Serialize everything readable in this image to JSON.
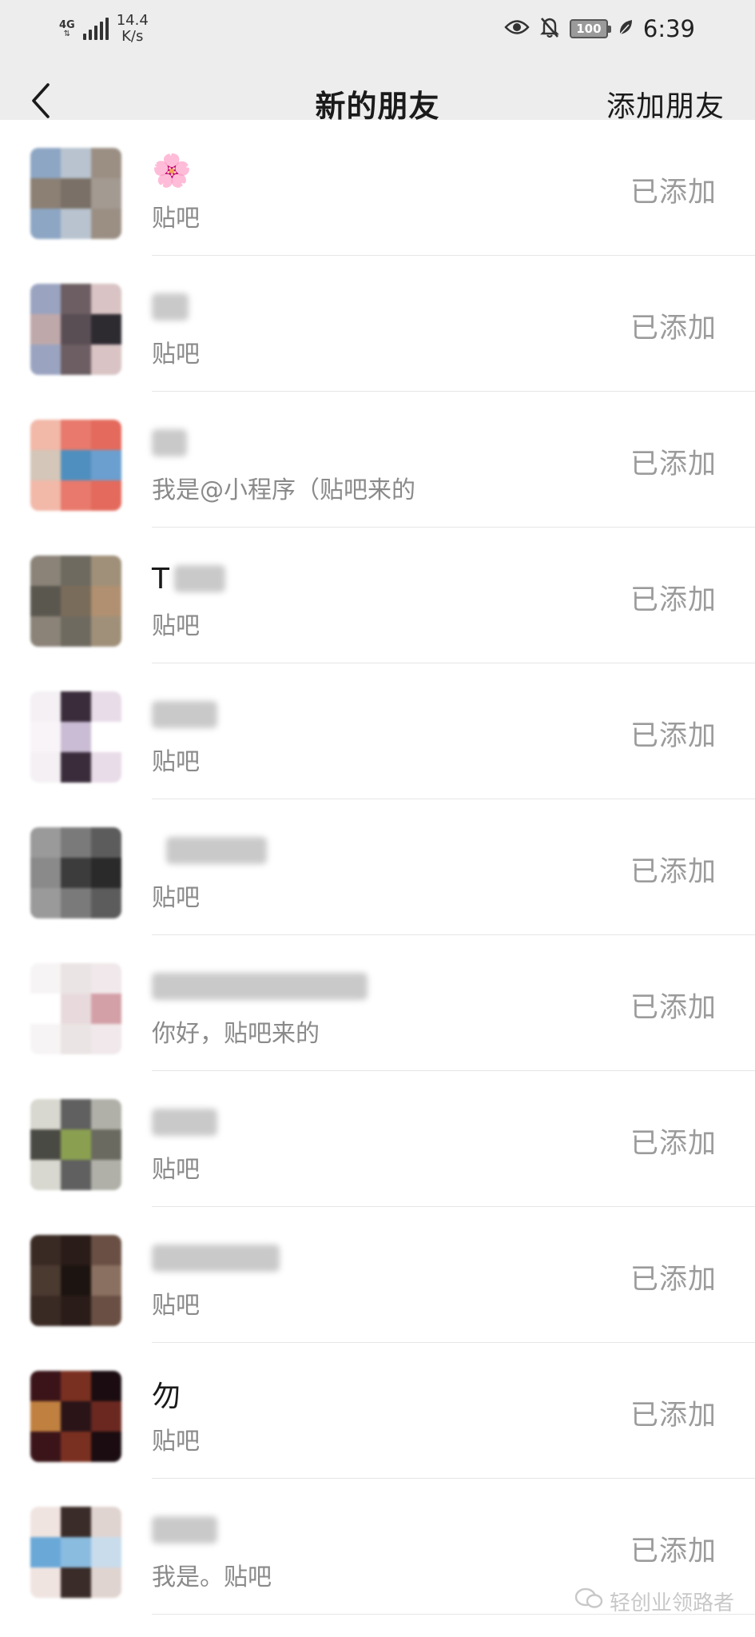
{
  "status_bar": {
    "net_type": "4G",
    "speed_value": "14.4",
    "speed_unit": "K/s",
    "battery": "100",
    "time": "6:39"
  },
  "nav": {
    "title": "新的朋友",
    "action": "添加朋友"
  },
  "friends": [
    {
      "name": "",
      "name_emoji": "🌸",
      "message": "贴吧",
      "status": "已添加",
      "avatar_colors": [
        "#8da6c4",
        "#b8c3cf",
        "#9b8f84",
        "#8c8074",
        "#7a7067",
        "#a39a92"
      ]
    },
    {
      "name": "",
      "message": "贴吧",
      "status": "已添加",
      "avatar_colors": [
        "#9aa4c0",
        "#6c5e62",
        "#d9c3c4",
        "#bfa8aa",
        "#5a4e55",
        "#2d2a30"
      ]
    },
    {
      "name": "",
      "message": "我是@小程序（贴吧来的",
      "status": "已添加",
      "avatar_colors": [
        "#f2b8a8",
        "#e8796c",
        "#e36a5c",
        "#d4c6b8",
        "#4f8fbf",
        "#6a9fcf"
      ]
    },
    {
      "name": "T",
      "message": "贴吧",
      "status": "已添加",
      "avatar_colors": [
        "#8b8378",
        "#6e6a60",
        "#a0907a",
        "#5a574f",
        "#7a6c5a",
        "#b09070"
      ]
    },
    {
      "name": "",
      "message": "贴吧",
      "status": "已添加",
      "avatar_colors": [
        "#f4f0f4",
        "#3a2c3a",
        "#e8dce8",
        "#f8f4f8",
        "#c9bcd4",
        "#ffffff"
      ]
    },
    {
      "name": "",
      "message": "贴吧",
      "status": "已添加",
      "avatar_colors": [
        "#9a9a9a",
        "#7a7a7a",
        "#5c5c5c",
        "#8a8a8a",
        "#3c3c3c",
        "#2a2a2a"
      ]
    },
    {
      "name": "",
      "message": "你好，贴吧来的",
      "status": "已添加",
      "avatar_colors": [
        "#f6f4f4",
        "#ebe4e4",
        "#f0e8ea",
        "#ffffff",
        "#e8dadc",
        "#d4a0a8"
      ]
    },
    {
      "name": "",
      "message": "贴吧",
      "status": "已添加",
      "avatar_colors": [
        "#d8d8d0",
        "#606060",
        "#b0b0a8",
        "#4a4a44",
        "#8aa050",
        "#6a6a60"
      ]
    },
    {
      "name": "",
      "message": "贴吧",
      "status": "已添加",
      "avatar_colors": [
        "#3a2a24",
        "#2a1c18",
        "#6a5044",
        "#4a3a30",
        "#1c1410",
        "#8a7060"
      ]
    },
    {
      "name": "勿",
      "message": "贴吧",
      "status": "已添加",
      "avatar_colors": [
        "#3a1418",
        "#7a3020",
        "#1a0c10",
        "#c08040",
        "#2a1418",
        "#6a2820"
      ]
    },
    {
      "name": "",
      "message": "我是。贴吧",
      "status": "已添加",
      "avatar_colors": [
        "#f0e4e0",
        "#3a2c28",
        "#e0d4d0",
        "#6aa8d8",
        "#8abce0",
        "#c8dcec"
      ]
    }
  ],
  "watermark": "轻创业领路者"
}
